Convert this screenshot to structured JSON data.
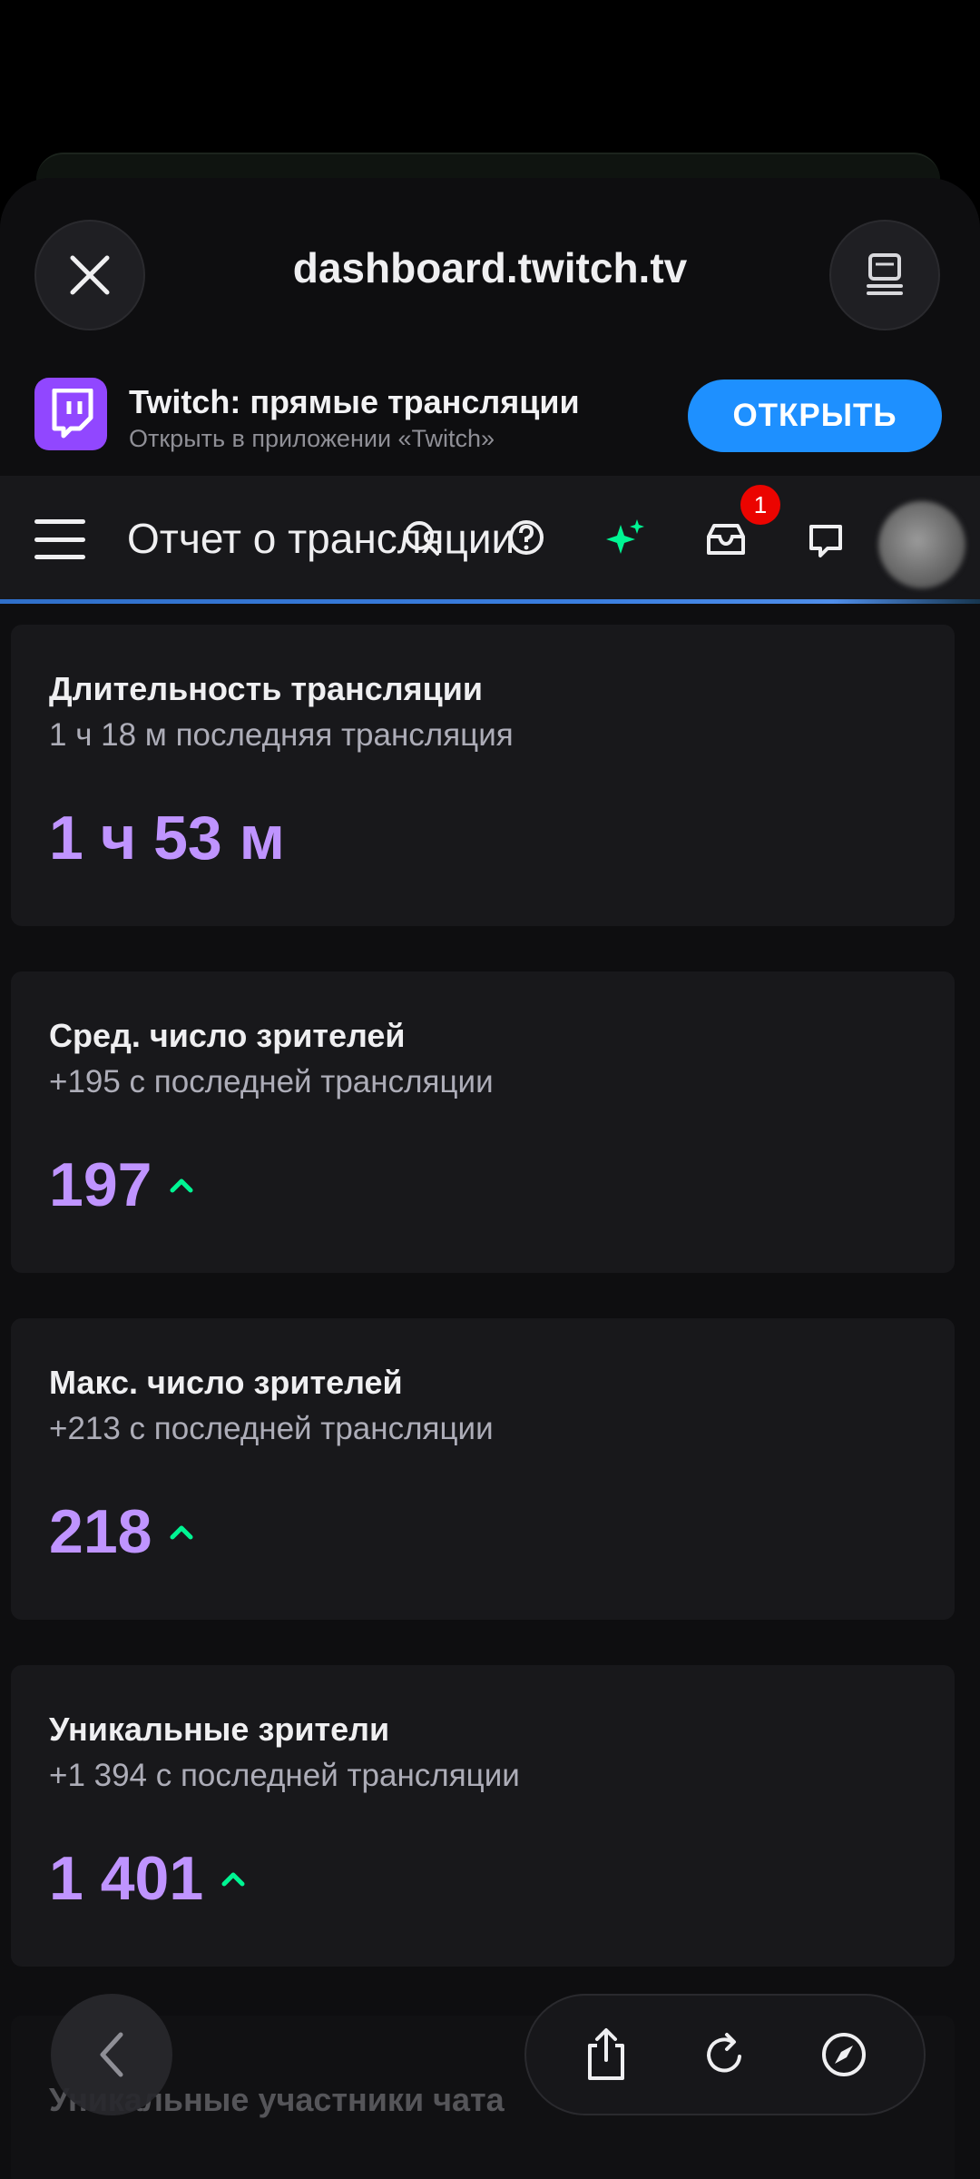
{
  "browser": {
    "url": "dashboard.twitch.tv",
    "close_icon": "close-icon",
    "desktop_icon": "desktop-mode-icon"
  },
  "app_banner": {
    "title": "Twitch: прямые трансляции",
    "subtitle": "Открыть в приложении «Twitch»",
    "open_label": "ОТКРЫТЬ",
    "accent": "#1e90ff"
  },
  "navbar": {
    "page_title": "Отчет о трансляции",
    "inbox_badge": "1",
    "icons": [
      "menu-icon",
      "search-icon",
      "help-icon",
      "sparkle-icon",
      "inbox-icon",
      "whispers-icon",
      "avatar"
    ]
  },
  "stats": [
    {
      "title": "Длительность трансляции",
      "subtitle": "1 ч 18 м последняя трансляция",
      "value": "1 ч 53 м",
      "trend": "none"
    },
    {
      "title": "Сред. число зрителей",
      "subtitle": "+195 с последней трансляции",
      "value": "197",
      "trend": "up"
    },
    {
      "title": "Макс. число зрителей",
      "subtitle": "+213 с последней трансляции",
      "value": "218",
      "trend": "up"
    },
    {
      "title": "Уникальные зрители",
      "subtitle": "+1 394 с последней трансляции",
      "value": "1 401",
      "trend": "up"
    }
  ],
  "partial_card": {
    "title": "Уникальные участники чата"
  },
  "colors": {
    "value_purple": "#bf94ff",
    "trend_green": "#00f593",
    "badge_red": "#eb0400"
  },
  "toolbar": {
    "icons": [
      "back-icon",
      "share-icon",
      "reload-icon",
      "compass-icon"
    ]
  }
}
